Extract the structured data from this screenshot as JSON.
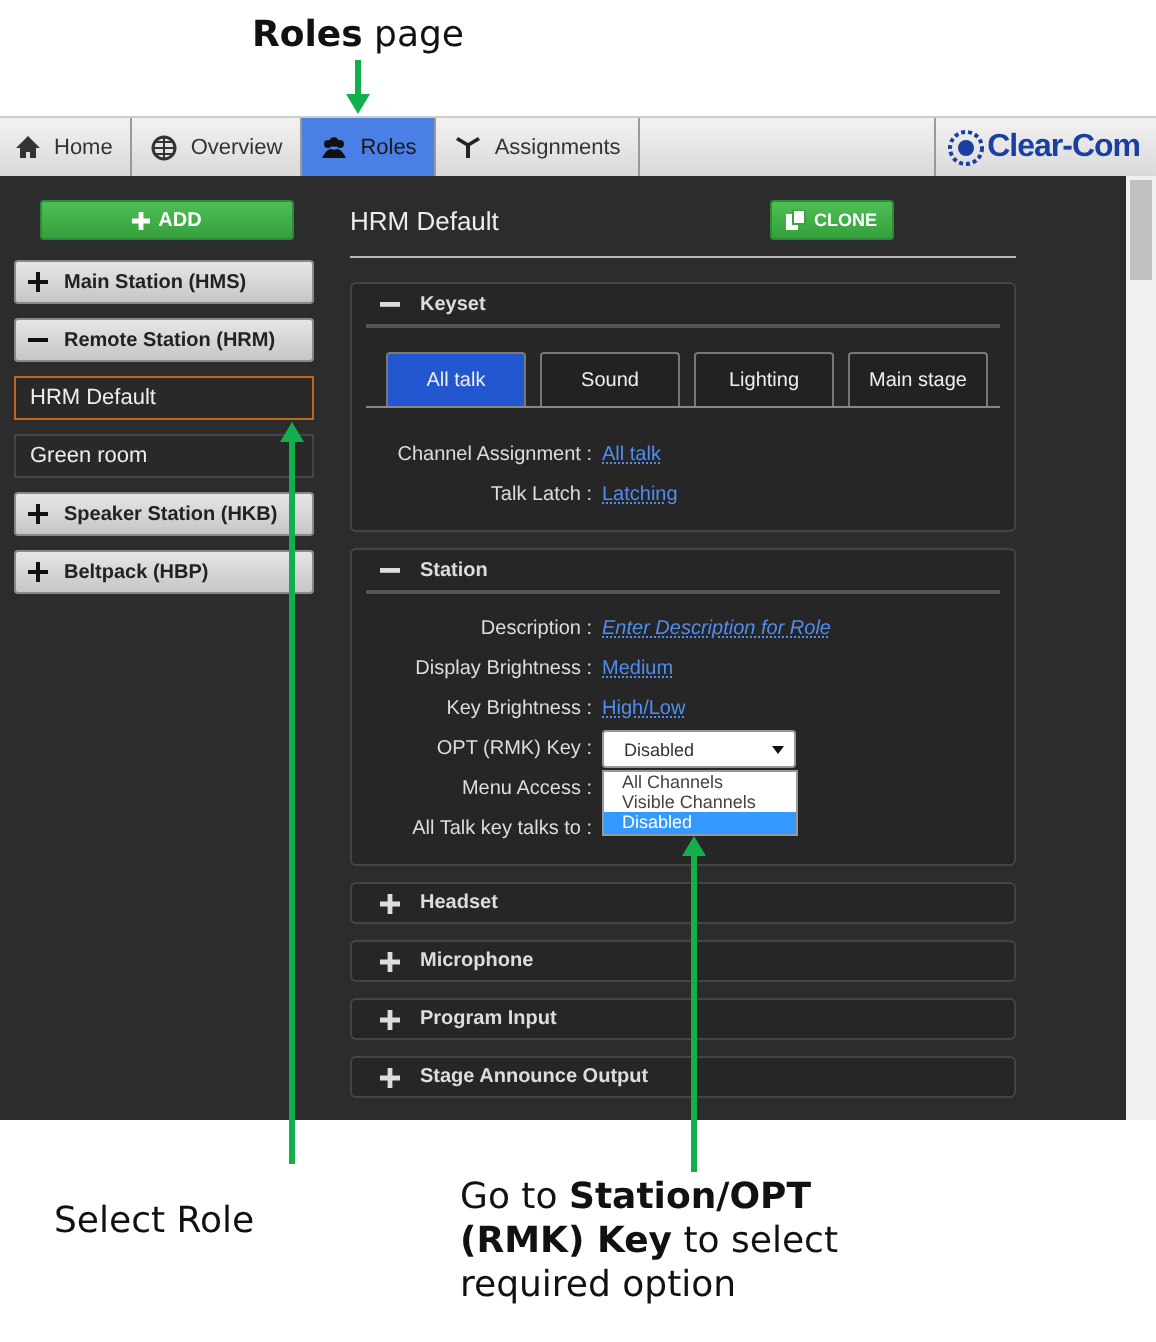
{
  "annotations": {
    "top_caption": "**Roles** page",
    "select_caption": "Select Role",
    "station_caption": "Go to **Station/OPT (RMK) Key** to select required option"
  },
  "nav": {
    "tabs": [
      {
        "label": "Home",
        "selected": false
      },
      {
        "label": "Overview",
        "selected": false
      },
      {
        "label": "Roles",
        "selected": true
      },
      {
        "label": "Assignments",
        "selected": false
      }
    ],
    "logo": "Clear-Com"
  },
  "sidebar": {
    "add_button": "ADD",
    "groups": [
      {
        "label": "Main Station (HMS)",
        "expanded": false
      },
      {
        "label": "Remote Station (HRM)",
        "expanded": true,
        "roles": [
          {
            "label": "HRM Default",
            "selected": true
          },
          {
            "label": "Green room",
            "selected": false
          }
        ]
      },
      {
        "label": "Speaker Station (HKB)",
        "expanded": false
      },
      {
        "label": "Beltpack (HBP)",
        "expanded": false
      }
    ]
  },
  "main": {
    "title": "HRM Default",
    "clone_button": "CLONE",
    "sections": [
      {
        "title": "Keyset",
        "expanded": true,
        "tabs": [
          {
            "label": "All talk",
            "selected": true
          },
          {
            "label": "Sound",
            "selected": false
          },
          {
            "label": "Lighting",
            "selected": false
          },
          {
            "label": "Main stage",
            "selected": false
          }
        ],
        "fields": [
          {
            "label": "Channel Assignment :",
            "kind": "link",
            "value": "All talk"
          },
          {
            "label": "Talk Latch :",
            "kind": "link",
            "value": "Latching"
          }
        ]
      },
      {
        "title": "Station",
        "expanded": true,
        "fields": [
          {
            "label": "Description :",
            "kind": "hint",
            "value": "Enter Description for Role"
          },
          {
            "label": "Display Brightness :",
            "kind": "link",
            "value": "Medium"
          },
          {
            "label": "Key Brightness :",
            "kind": "link",
            "value": "High/Low"
          },
          {
            "label": "OPT (RMK) Key :",
            "kind": "select",
            "value": "Disabled",
            "open": true,
            "options": [
              {
                "label": "All Channels",
                "selected": false
              },
              {
                "label": "Visible Channels",
                "selected": false
              },
              {
                "label": "Disabled",
                "selected": true
              }
            ]
          },
          {
            "label": "Menu Access :",
            "kind": "label"
          },
          {
            "label": "All Talk key talks to :",
            "kind": "label"
          }
        ]
      },
      {
        "title": "Headset",
        "expanded": false
      },
      {
        "title": "Microphone",
        "expanded": false
      },
      {
        "title": "Program Input",
        "expanded": false
      },
      {
        "title": "Stage Announce Output",
        "expanded": false
      }
    ]
  }
}
